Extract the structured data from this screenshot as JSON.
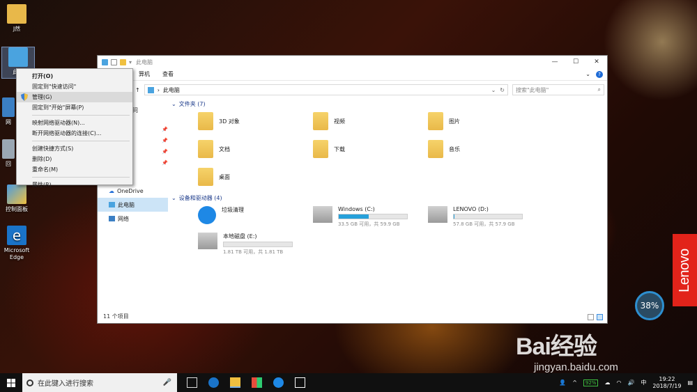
{
  "desktop": {
    "icons": [
      {
        "label": "J然"
      },
      {
        "label": "此电"
      },
      {
        "label": "网"
      },
      {
        "label": "回"
      },
      {
        "label": "控制面板"
      },
      {
        "label": "Microsoft Edge"
      }
    ]
  },
  "explorer": {
    "title": "此电脑",
    "ribbon_tabs": [
      "算机",
      "查看"
    ],
    "address": "此电脑",
    "search_placeholder": "搜索\"此电脑\"",
    "nav": {
      "partial_item": "问",
      "onedrive": "OneDrive",
      "this_pc": "此电脑",
      "network": "网络"
    },
    "groups": {
      "folders_header": "文件夹 (7)",
      "devices_header": "设备和驱动器 (4)"
    },
    "folders": [
      {
        "label": "3D 对象"
      },
      {
        "label": "视频"
      },
      {
        "label": "图片"
      },
      {
        "label": "文档"
      },
      {
        "label": "下载"
      },
      {
        "label": "音乐"
      },
      {
        "label": "桌面"
      }
    ],
    "drives": [
      {
        "label": "垃圾清理",
        "sub": ""
      },
      {
        "label": "Windows (C:)",
        "sub": "33.5 GB 可用，共 59.9 GB",
        "used_fraction": 0.44
      },
      {
        "label": "LENOVO (D:)",
        "sub": "57.8 GB 可用，共 57.9 GB",
        "used_fraction": 0.002
      },
      {
        "label": "本地磁盘 (E:)",
        "sub": "1.81 TB 可用，共 1.81 TB",
        "used_fraction": 0.0
      }
    ],
    "status": "11 个项目"
  },
  "context_menu": {
    "items": [
      "打开(O)",
      "固定到\"快速访问\"",
      "管理(G)",
      "固定到\"开始\"屏幕(P)",
      "映射网络驱动器(N)...",
      "断开网络驱动器的连接(C)...",
      "创建快捷方式(S)",
      "删除(D)",
      "重命名(M)",
      "属性(R)"
    ]
  },
  "lenovo": {
    "brand": "Lenovo"
  },
  "speed_badge": {
    "value": "38%"
  },
  "watermark": {
    "big": "Bai经验",
    "small": "jingyan.baidu.com"
  },
  "taskbar": {
    "search_placeholder": "在此键入进行搜索",
    "battery": "92%",
    "time": "19:22",
    "date": "2018/7/19"
  }
}
